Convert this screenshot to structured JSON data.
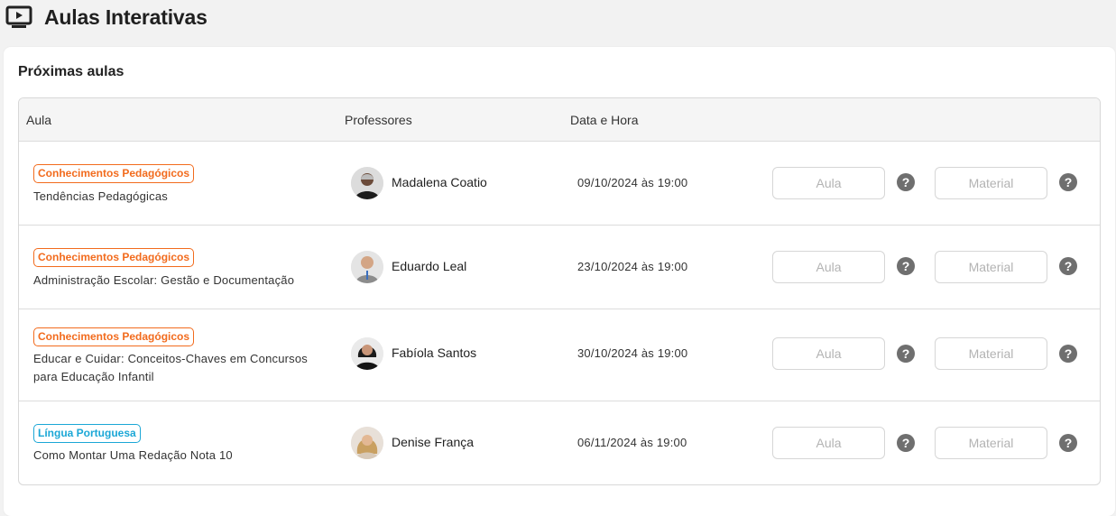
{
  "page": {
    "title": "Aulas Interativas",
    "icon": "play-tv-icon"
  },
  "section": {
    "title": "Próximas aulas"
  },
  "table": {
    "headers": {
      "aula": "Aula",
      "professores": "Professores",
      "data_hora": "Data e Hora"
    },
    "rows": [
      {
        "tag": "Conhecimentos Pedagógicos",
        "tag_color": "#f26b1d",
        "title_lines": [
          "Tendências Pedagógicas"
        ],
        "professor": "Madalena Coatio",
        "date": "09/10/2024 às 19:00",
        "aula_button": "Aula",
        "material_button": "Material",
        "help": "?"
      },
      {
        "tag": "Conhecimentos Pedagógicos",
        "tag_color": "#f26b1d",
        "title_lines": [
          "Administração Escolar: Gestão e Documentação"
        ],
        "professor": "Eduardo Leal",
        "date": "23/10/2024 às 19:00",
        "aula_button": "Aula",
        "material_button": "Material",
        "help": "?"
      },
      {
        "tag": "Conhecimentos Pedagógicos",
        "tag_color": "#f26b1d",
        "title_lines": [
          "Educar e Cuidar: Conceitos-Chaves em Concursos",
          "para Educação Infantil"
        ],
        "professor": "Fabíola Santos",
        "date": "30/10/2024 às 19:00",
        "aula_button": "Aula",
        "material_button": "Material",
        "help": "?"
      },
      {
        "tag": "Língua Portuguesa",
        "tag_color": "#1ba7d6",
        "title_lines": [
          "Como Montar Uma Redação Nota 10"
        ],
        "professor": "Denise França",
        "date": "06/11/2024 às 19:00",
        "aula_button": "Aula",
        "material_button": "Material",
        "help": "?"
      }
    ]
  }
}
